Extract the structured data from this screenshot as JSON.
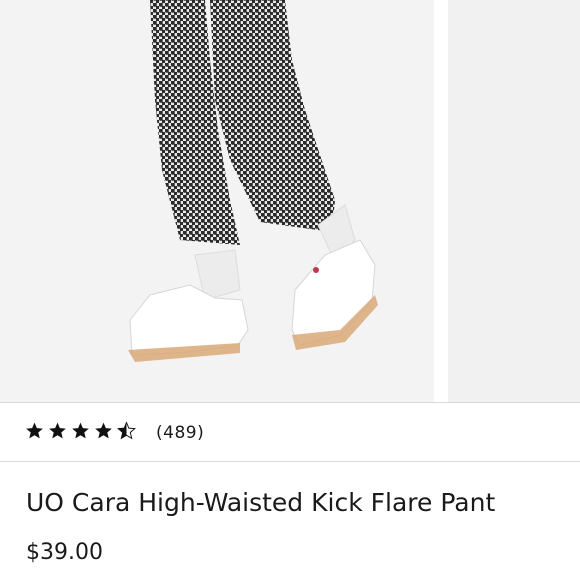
{
  "product": {
    "title": "UO Cara High-Waisted Kick Flare Pant",
    "price": "$39.00",
    "rating_value": 4.5,
    "rating_max": 5,
    "review_count": "(489)"
  },
  "gallery": {
    "image_description_icon": "product-photo",
    "colors": {
      "check_dark": "#2b2b2b",
      "check_light": "#e9e9e9",
      "background": "#f3f3f3"
    }
  },
  "icons": {
    "star": "star-icon",
    "half_star": "star-half-icon"
  }
}
